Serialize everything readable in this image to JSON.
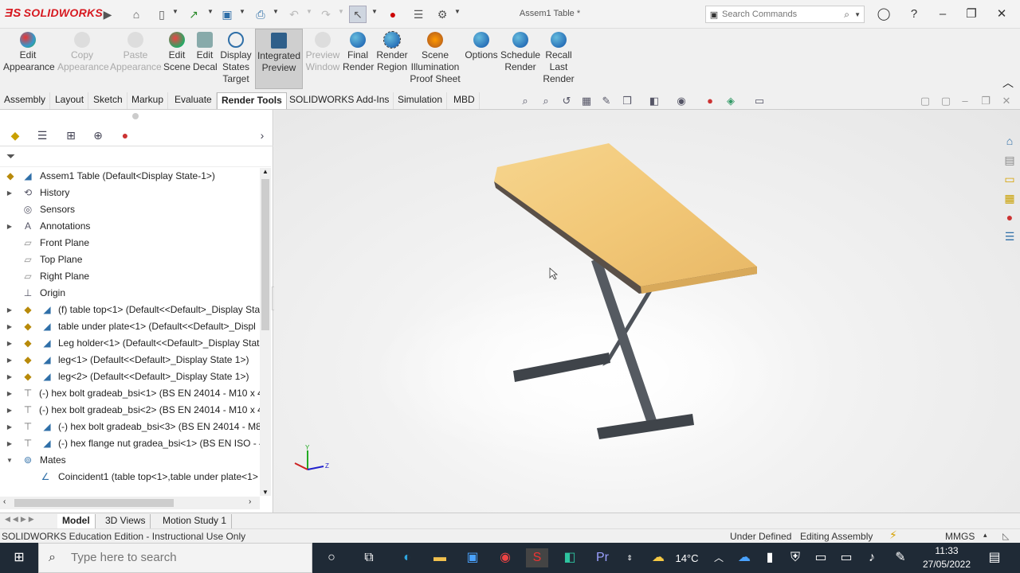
{
  "app": {
    "brand": "SOLIDWORKS",
    "document_title": "Assem1 Table *",
    "search_placeholder": "Search Commands"
  },
  "ribbon": {
    "buttons": [
      {
        "label": "Edit Appearance",
        "enabled": true
      },
      {
        "label": "Copy Appearance",
        "enabled": false
      },
      {
        "label": "Paste Appearance",
        "enabled": false
      },
      {
        "label": "Edit Scene",
        "enabled": true
      },
      {
        "label": "Edit Decal",
        "enabled": true
      },
      {
        "label": "Display States Target",
        "enabled": true
      },
      {
        "label": "Integrated Preview",
        "enabled": true,
        "active": true
      },
      {
        "label": "Preview Window",
        "enabled": false
      },
      {
        "label": "Final Render",
        "enabled": true
      },
      {
        "label": "Render Region",
        "enabled": true
      },
      {
        "label": "Scene Illumination Proof Sheet",
        "enabled": true
      },
      {
        "label": "Options",
        "enabled": true
      },
      {
        "label": "Schedule Render",
        "enabled": true
      },
      {
        "label": "Recall Last Render",
        "enabled": true
      }
    ]
  },
  "tabs": [
    "Assembly",
    "Layout",
    "Sketch",
    "Markup",
    "Evaluate",
    "Render Tools",
    "SOLIDWORKS Add-Ins",
    "Simulation",
    "MBD"
  ],
  "active_tab": "Render Tools",
  "tree": {
    "root": "Assem1 Table  (Default<Display State-1>)",
    "items": [
      {
        "label": "History",
        "icon": "history-icon",
        "expandable": true
      },
      {
        "label": "Sensors",
        "icon": "sensors-icon",
        "expandable": false
      },
      {
        "label": "Annotations",
        "icon": "annotations-icon",
        "expandable": true
      },
      {
        "label": "Front Plane",
        "icon": "plane-icon",
        "expandable": false
      },
      {
        "label": "Top Plane",
        "icon": "plane-icon",
        "expandable": false
      },
      {
        "label": "Right Plane",
        "icon": "plane-icon",
        "expandable": false
      },
      {
        "label": "Origin",
        "icon": "origin-icon",
        "expandable": false
      },
      {
        "label": "(f) table top<1> (Default<<Default>_Display Sta",
        "icon": "part-icon",
        "expandable": true
      },
      {
        "label": "table under plate<1> (Default<<Default>_Displ",
        "icon": "part-icon",
        "expandable": true
      },
      {
        "label": "Leg holder<1> (Default<<Default>_Display Stat",
        "icon": "part-icon",
        "expandable": true
      },
      {
        "label": "leg<1> (Default<<Default>_Display State 1>)",
        "icon": "part-icon",
        "expandable": true
      },
      {
        "label": "leg<2> (Default<<Default>_Display State 1>)",
        "icon": "part-icon",
        "expandable": true
      },
      {
        "label": "(-) hex bolt gradeab_bsi<1> (BS EN 24014 - M10 x 4",
        "icon": "bolt-icon",
        "expandable": true
      },
      {
        "label": "(-) hex bolt gradeab_bsi<2> (BS EN 24014 - M10 x 4",
        "icon": "bolt-icon",
        "expandable": true
      },
      {
        "label": "(-) hex bolt gradeab_bsi<3> (BS EN 24014 - M8",
        "icon": "bolt-icon",
        "expandable": true
      },
      {
        "label": "(-) hex flange nut gradea_bsi<1> (BS EN ISO - 4",
        "icon": "nut-icon",
        "expandable": true
      },
      {
        "label": "Mates",
        "icon": "mates-icon",
        "expandable": true,
        "expanded": true
      },
      {
        "label": "Coincident1 (table top<1>,table under plate<1>",
        "icon": "coincident-icon",
        "expandable": false
      }
    ]
  },
  "bottom_tabs": [
    "Model",
    "3D Views",
    "Motion Study 1"
  ],
  "active_bottom_tab": "Model",
  "status": {
    "left": "SOLIDWORKS Education Edition - Instructional Use Only",
    "definition": "Under Defined",
    "mode": "Editing Assembly",
    "units": "MMGS"
  },
  "taskbar": {
    "search_placeholder": "Type here to search",
    "temperature": "14°C",
    "time": "11:33",
    "date": "27/05/2022"
  },
  "triad": {
    "y": "Y",
    "z": "Z"
  },
  "colors": {
    "brand_red": "#d71920",
    "taskbar": "#1f2a36",
    "tabletop": "#f2c878",
    "legs": "#4a4f55"
  }
}
